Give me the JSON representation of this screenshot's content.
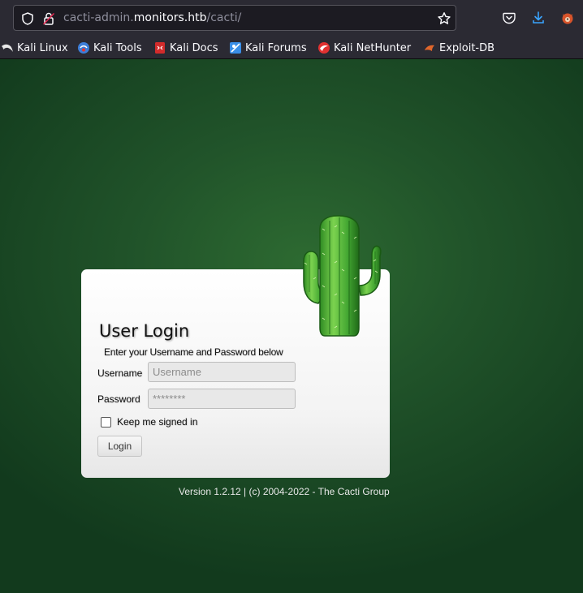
{
  "browser": {
    "url_prefix": "cacti-admin.",
    "url_host": "monitors.htb",
    "url_path": "/cacti/",
    "bookmarks": [
      {
        "label": "Kali Linux",
        "icon": "kali-dragon-icon"
      },
      {
        "label": "Kali Tools",
        "icon": "kali-tools-icon"
      },
      {
        "label": "Kali Docs",
        "icon": "kali-docs-icon"
      },
      {
        "label": "Kali Forums",
        "icon": "kali-forums-icon"
      },
      {
        "label": "Kali NetHunter",
        "icon": "kali-nethunter-icon"
      },
      {
        "label": "Exploit-DB",
        "icon": "exploit-db-icon"
      }
    ]
  },
  "login": {
    "title": "User Login",
    "subtitle": "Enter your Username and Password below",
    "username_label": "Username",
    "username_placeholder": "Username",
    "password_label": "Password",
    "password_placeholder": "********",
    "remember_label": "Keep me signed in",
    "submit_label": "Login"
  },
  "footer": {
    "version_text": "Version 1.2.12 | (c) 2004-2022 - The Cacti Group"
  },
  "colors": {
    "background_green": "#21542a",
    "card": "#ffffff",
    "cactus": "#4caf3b"
  }
}
